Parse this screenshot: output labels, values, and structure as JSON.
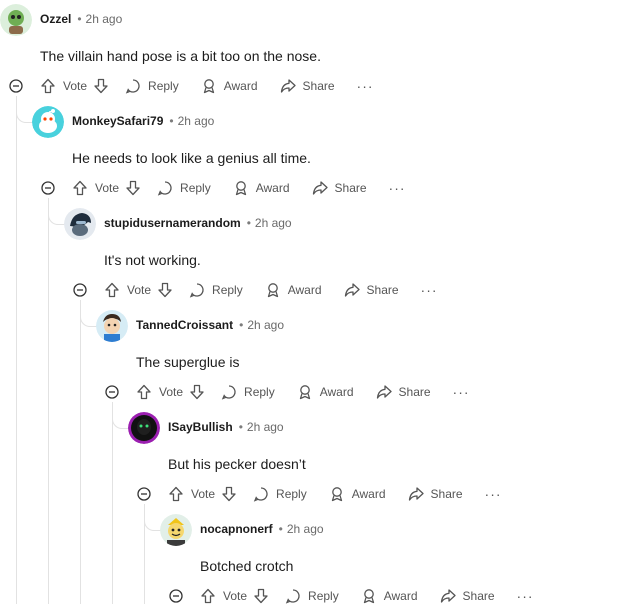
{
  "actions": {
    "vote": "Vote",
    "reply": "Reply",
    "award": "Award",
    "share": "Share",
    "more": "···"
  },
  "comments": [
    {
      "author": "Ozzel",
      "separator": "•",
      "time": "2h ago",
      "text": "The villain hand pose is a bit too on the nose.",
      "avatar_color": "#9fd3a6"
    },
    {
      "author": "MonkeySafari79",
      "separator": "•",
      "time": "2h ago",
      "text": "He needs to look like a genius all time.",
      "avatar_color": "#48d1dd"
    },
    {
      "author": "stupidusernamerandom",
      "separator": "•",
      "time": "2h ago",
      "text": "It's not working.",
      "avatar_color": "#dfe6ee"
    },
    {
      "author": "TannedCroissant",
      "separator": "•",
      "time": "2h ago",
      "text": "The superglue is",
      "avatar_color": "#cde7f2"
    },
    {
      "author": "ISayBullish",
      "separator": "•",
      "time": "2h ago",
      "text": "But his pecker doesn’t",
      "avatar_color": "#9b1fb0"
    },
    {
      "author": "nocapnonerf",
      "separator": "•",
      "time": "2h ago",
      "text": "Botched crotch",
      "avatar_color": "#dfeee6"
    }
  ],
  "colors": {
    "thread_line": "#e2e2e2",
    "meta_text": "#6a6a6a",
    "action_text": "#555555"
  }
}
